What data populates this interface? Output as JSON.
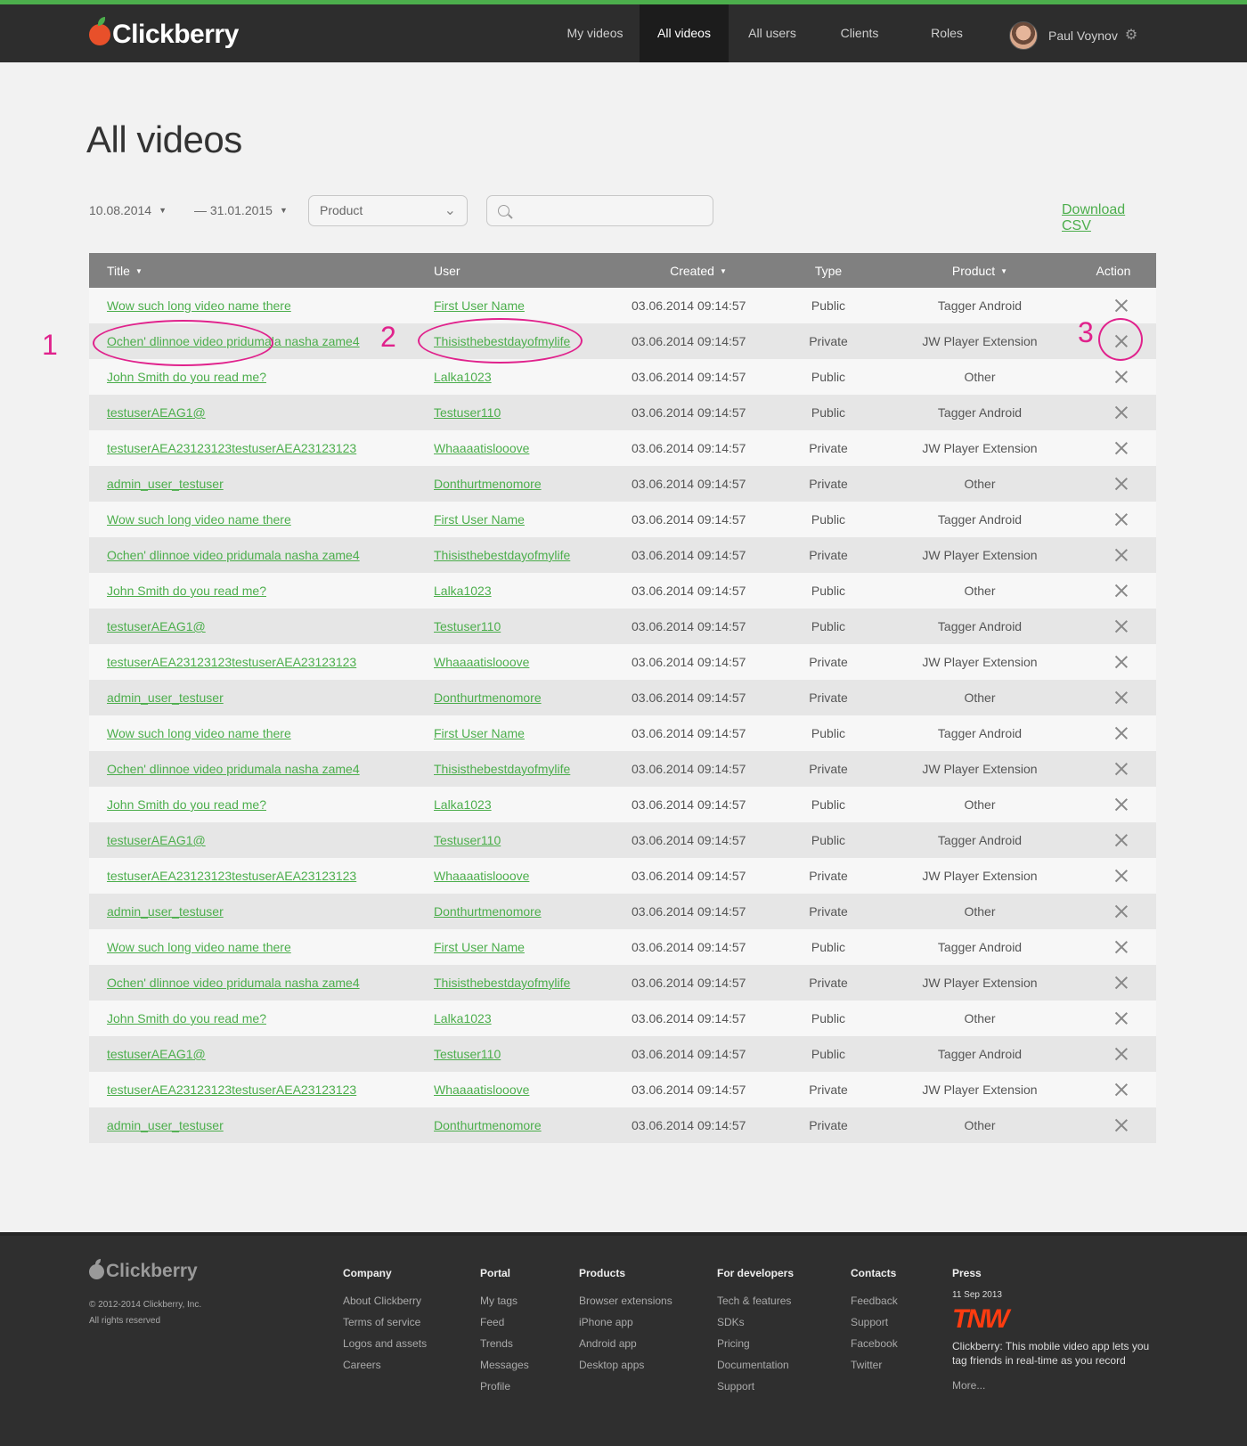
{
  "header": {
    "logo": "Clickberry",
    "nav": [
      {
        "label": "My videos",
        "active": false
      },
      {
        "label": "All videos",
        "active": true
      },
      {
        "label": "All users",
        "active": false
      },
      {
        "label": "Clients",
        "active": false
      },
      {
        "label": "Roles",
        "active": false
      }
    ],
    "user_name": "Paul Voynov"
  },
  "page": {
    "title": "All videos"
  },
  "filters": {
    "date_from": "10.08.2014",
    "date_to": "— 31.01.2015",
    "product_label": "Product",
    "search_placeholder": "",
    "download_label": "Download CSV"
  },
  "table": {
    "headers": {
      "title": "Title",
      "user": "User",
      "created": "Created",
      "type": "Type",
      "product": "Product",
      "action": "Action"
    },
    "rows": [
      {
        "title": "Wow such long video name there",
        "user": "First User Name",
        "created": "03.06.2014  09:14:57",
        "type": "Public",
        "product": "Tagger Android"
      },
      {
        "title": "Ochen' dlinnoe video pridumala nasha zame4",
        "user": "Thisisthebestdayofmylife",
        "created": "03.06.2014  09:14:57",
        "type": "Private",
        "product": "JW Player Extension"
      },
      {
        "title": "John Smith do you read me?",
        "user": "Lalka1023",
        "created": "03.06.2014  09:14:57",
        "type": "Public",
        "product": "Other"
      },
      {
        "title": "testuserAEAG1@",
        "user": "Testuser110",
        "created": "03.06.2014  09:14:57",
        "type": "Public",
        "product": "Tagger Android"
      },
      {
        "title": "testuserAEA23123123testuserAEA23123123",
        "user": "Whaaaatislooove",
        "created": "03.06.2014  09:14:57",
        "type": "Private",
        "product": "JW Player Extension"
      },
      {
        "title": "admin_user_testuser",
        "user": "Donthurtmenomore",
        "created": "03.06.2014  09:14:57",
        "type": "Private",
        "product": "Other"
      },
      {
        "title": "Wow such long video name there",
        "user": "First User Name",
        "created": "03.06.2014  09:14:57",
        "type": "Public",
        "product": "Tagger Android"
      },
      {
        "title": "Ochen' dlinnoe video pridumala nasha zame4",
        "user": "Thisisthebestdayofmylife",
        "created": "03.06.2014  09:14:57",
        "type": "Private",
        "product": "JW Player Extension"
      },
      {
        "title": "John Smith do you read me?",
        "user": "Lalka1023",
        "created": "03.06.2014  09:14:57",
        "type": "Public",
        "product": "Other"
      },
      {
        "title": "testuserAEAG1@",
        "user": "Testuser110",
        "created": "03.06.2014  09:14:57",
        "type": "Public",
        "product": "Tagger Android"
      },
      {
        "title": "testuserAEA23123123testuserAEA23123123",
        "user": "Whaaaatislooove",
        "created": "03.06.2014  09:14:57",
        "type": "Private",
        "product": "JW Player Extension"
      },
      {
        "title": "admin_user_testuser",
        "user": "Donthurtmenomore",
        "created": "03.06.2014  09:14:57",
        "type": "Private",
        "product": "Other"
      },
      {
        "title": "Wow such long video name there",
        "user": "First User Name",
        "created": "03.06.2014  09:14:57",
        "type": "Public",
        "product": "Tagger Android"
      },
      {
        "title": "Ochen' dlinnoe video pridumala nasha zame4",
        "user": "Thisisthebestdayofmylife",
        "created": "03.06.2014  09:14:57",
        "type": "Private",
        "product": "JW Player Extension"
      },
      {
        "title": "John Smith do you read me?",
        "user": "Lalka1023",
        "created": "03.06.2014  09:14:57",
        "type": "Public",
        "product": "Other"
      },
      {
        "title": "testuserAEAG1@",
        "user": "Testuser110",
        "created": "03.06.2014  09:14:57",
        "type": "Public",
        "product": "Tagger Android"
      },
      {
        "title": "testuserAEA23123123testuserAEA23123123",
        "user": "Whaaaatislooove",
        "created": "03.06.2014  09:14:57",
        "type": "Private",
        "product": "JW Player Extension"
      },
      {
        "title": "admin_user_testuser",
        "user": "Donthurtmenomore",
        "created": "03.06.2014  09:14:57",
        "type": "Private",
        "product": "Other"
      },
      {
        "title": "Wow such long video name there",
        "user": "First User Name",
        "created": "03.06.2014  09:14:57",
        "type": "Public",
        "product": "Tagger Android"
      },
      {
        "title": "Ochen' dlinnoe video pridumala nasha zame4",
        "user": "Thisisthebestdayofmylife",
        "created": "03.06.2014  09:14:57",
        "type": "Private",
        "product": "JW Player Extension"
      },
      {
        "title": "John Smith do you read me?",
        "user": "Lalka1023",
        "created": "03.06.2014  09:14:57",
        "type": "Public",
        "product": "Other"
      },
      {
        "title": "testuserAEAG1@",
        "user": "Testuser110",
        "created": "03.06.2014  09:14:57",
        "type": "Public",
        "product": "Tagger Android"
      },
      {
        "title": "testuserAEA23123123testuserAEA23123123",
        "user": "Whaaaatislooove",
        "created": "03.06.2014  09:14:57",
        "type": "Private",
        "product": "JW Player Extension"
      },
      {
        "title": "admin_user_testuser",
        "user": "Donthurtmenomore",
        "created": "03.06.2014  09:14:57",
        "type": "Private",
        "product": "Other"
      }
    ]
  },
  "annotations": [
    "1",
    "2",
    "3"
  ],
  "footer": {
    "logo": "Clickberry",
    "copyright": "© 2012-2014 Clickberry, Inc.",
    "rights": "All rights reserved",
    "columns": [
      {
        "heading": "Company",
        "links": [
          "About Clickberry",
          "Terms of service",
          "Logos and assets",
          "Careers"
        ]
      },
      {
        "heading": "Portal",
        "links": [
          "My tags",
          "Feed",
          "Trends",
          "Messages",
          "Profile"
        ]
      },
      {
        "heading": "Products",
        "links": [
          "Browser extensions",
          "iPhone app",
          "Android app",
          "Desktop apps"
        ]
      },
      {
        "heading": "For developers",
        "links": [
          "Tech & features",
          "SDKs",
          "Pricing",
          "Documentation",
          "Support"
        ]
      },
      {
        "heading": "Contacts",
        "links": [
          "Feedback",
          "Support",
          "Facebook",
          "Twitter"
        ]
      }
    ],
    "press": {
      "heading": "Press",
      "date": "11 Sep 2013",
      "logo": "TNW",
      "text": "Clickberry: This mobile video app lets you tag friends in real-time as you record",
      "more": "More..."
    }
  },
  "colors": {
    "accent": "#4cae4c",
    "header_bg": "#2d2d2d",
    "table_header_bg": "#808080",
    "annotation": "#e0228c",
    "press_logo": "#ff3c10"
  }
}
